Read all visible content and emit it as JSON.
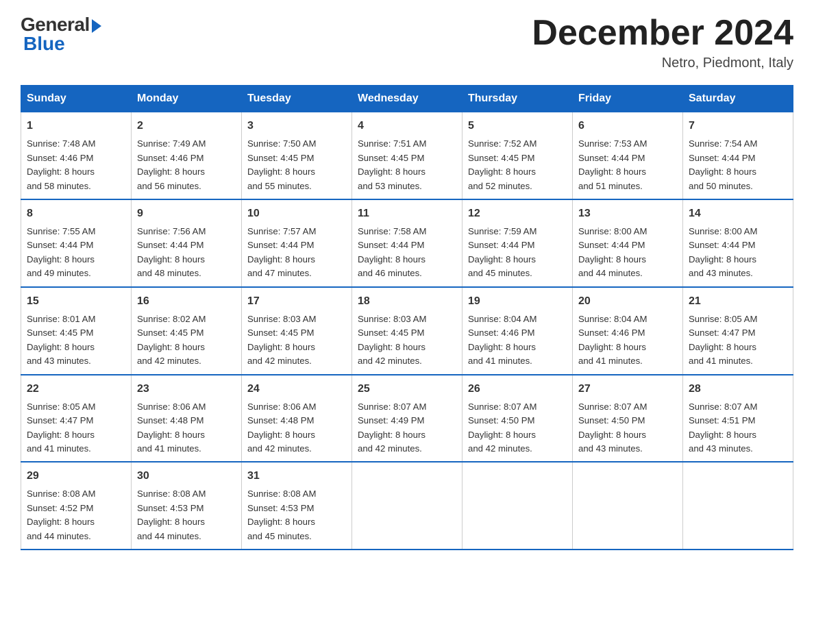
{
  "logo": {
    "general": "General",
    "blue": "Blue"
  },
  "title": "December 2024",
  "location": "Netro, Piedmont, Italy",
  "days_of_week": [
    "Sunday",
    "Monday",
    "Tuesday",
    "Wednesday",
    "Thursday",
    "Friday",
    "Saturday"
  ],
  "weeks": [
    [
      {
        "day": "1",
        "sunrise": "7:48 AM",
        "sunset": "4:46 PM",
        "daylight": "8 hours and 58 minutes."
      },
      {
        "day": "2",
        "sunrise": "7:49 AM",
        "sunset": "4:46 PM",
        "daylight": "8 hours and 56 minutes."
      },
      {
        "day": "3",
        "sunrise": "7:50 AM",
        "sunset": "4:45 PM",
        "daylight": "8 hours and 55 minutes."
      },
      {
        "day": "4",
        "sunrise": "7:51 AM",
        "sunset": "4:45 PM",
        "daylight": "8 hours and 53 minutes."
      },
      {
        "day": "5",
        "sunrise": "7:52 AM",
        "sunset": "4:45 PM",
        "daylight": "8 hours and 52 minutes."
      },
      {
        "day": "6",
        "sunrise": "7:53 AM",
        "sunset": "4:44 PM",
        "daylight": "8 hours and 51 minutes."
      },
      {
        "day": "7",
        "sunrise": "7:54 AM",
        "sunset": "4:44 PM",
        "daylight": "8 hours and 50 minutes."
      }
    ],
    [
      {
        "day": "8",
        "sunrise": "7:55 AM",
        "sunset": "4:44 PM",
        "daylight": "8 hours and 49 minutes."
      },
      {
        "day": "9",
        "sunrise": "7:56 AM",
        "sunset": "4:44 PM",
        "daylight": "8 hours and 48 minutes."
      },
      {
        "day": "10",
        "sunrise": "7:57 AM",
        "sunset": "4:44 PM",
        "daylight": "8 hours and 47 minutes."
      },
      {
        "day": "11",
        "sunrise": "7:58 AM",
        "sunset": "4:44 PM",
        "daylight": "8 hours and 46 minutes."
      },
      {
        "day": "12",
        "sunrise": "7:59 AM",
        "sunset": "4:44 PM",
        "daylight": "8 hours and 45 minutes."
      },
      {
        "day": "13",
        "sunrise": "8:00 AM",
        "sunset": "4:44 PM",
        "daylight": "8 hours and 44 minutes."
      },
      {
        "day": "14",
        "sunrise": "8:00 AM",
        "sunset": "4:44 PM",
        "daylight": "8 hours and 43 minutes."
      }
    ],
    [
      {
        "day": "15",
        "sunrise": "8:01 AM",
        "sunset": "4:45 PM",
        "daylight": "8 hours and 43 minutes."
      },
      {
        "day": "16",
        "sunrise": "8:02 AM",
        "sunset": "4:45 PM",
        "daylight": "8 hours and 42 minutes."
      },
      {
        "day": "17",
        "sunrise": "8:03 AM",
        "sunset": "4:45 PM",
        "daylight": "8 hours and 42 minutes."
      },
      {
        "day": "18",
        "sunrise": "8:03 AM",
        "sunset": "4:45 PM",
        "daylight": "8 hours and 42 minutes."
      },
      {
        "day": "19",
        "sunrise": "8:04 AM",
        "sunset": "4:46 PM",
        "daylight": "8 hours and 41 minutes."
      },
      {
        "day": "20",
        "sunrise": "8:04 AM",
        "sunset": "4:46 PM",
        "daylight": "8 hours and 41 minutes."
      },
      {
        "day": "21",
        "sunrise": "8:05 AM",
        "sunset": "4:47 PM",
        "daylight": "8 hours and 41 minutes."
      }
    ],
    [
      {
        "day": "22",
        "sunrise": "8:05 AM",
        "sunset": "4:47 PM",
        "daylight": "8 hours and 41 minutes."
      },
      {
        "day": "23",
        "sunrise": "8:06 AM",
        "sunset": "4:48 PM",
        "daylight": "8 hours and 41 minutes."
      },
      {
        "day": "24",
        "sunrise": "8:06 AM",
        "sunset": "4:48 PM",
        "daylight": "8 hours and 42 minutes."
      },
      {
        "day": "25",
        "sunrise": "8:07 AM",
        "sunset": "4:49 PM",
        "daylight": "8 hours and 42 minutes."
      },
      {
        "day": "26",
        "sunrise": "8:07 AM",
        "sunset": "4:50 PM",
        "daylight": "8 hours and 42 minutes."
      },
      {
        "day": "27",
        "sunrise": "8:07 AM",
        "sunset": "4:50 PM",
        "daylight": "8 hours and 43 minutes."
      },
      {
        "day": "28",
        "sunrise": "8:07 AM",
        "sunset": "4:51 PM",
        "daylight": "8 hours and 43 minutes."
      }
    ],
    [
      {
        "day": "29",
        "sunrise": "8:08 AM",
        "sunset": "4:52 PM",
        "daylight": "8 hours and 44 minutes."
      },
      {
        "day": "30",
        "sunrise": "8:08 AM",
        "sunset": "4:53 PM",
        "daylight": "8 hours and 44 minutes."
      },
      {
        "day": "31",
        "sunrise": "8:08 AM",
        "sunset": "4:53 PM",
        "daylight": "8 hours and 45 minutes."
      },
      null,
      null,
      null,
      null
    ]
  ],
  "labels": {
    "sunrise": "Sunrise:",
    "sunset": "Sunset:",
    "daylight": "Daylight:"
  }
}
